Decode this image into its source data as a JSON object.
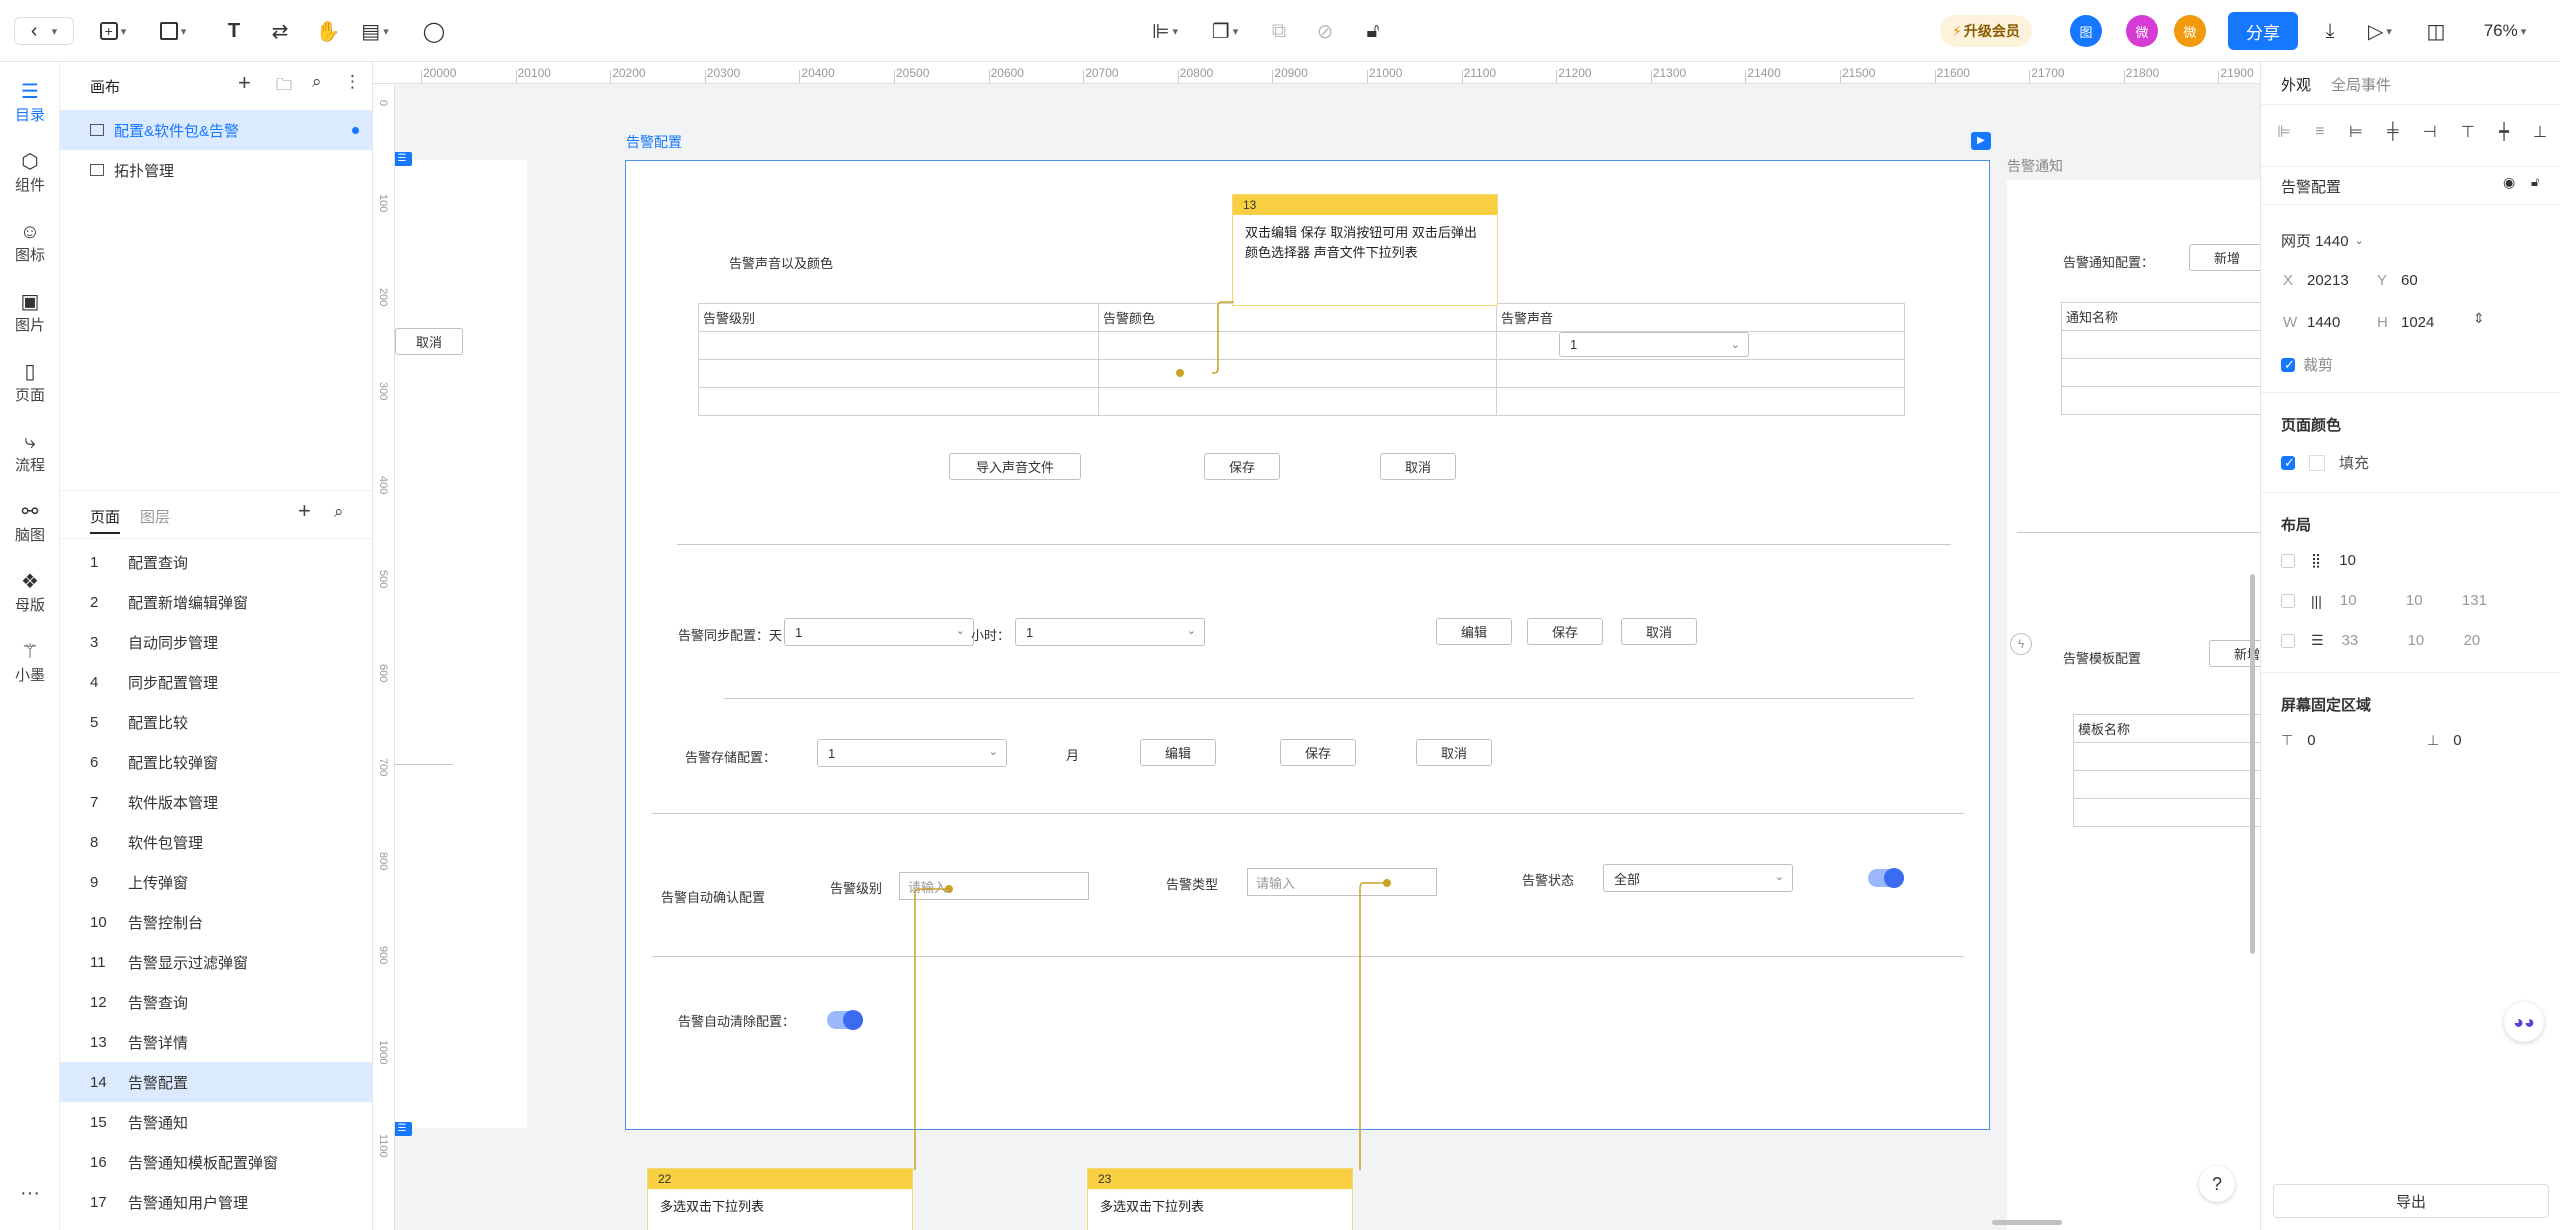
{
  "toolbar": {
    "upgrade_label": "升级会员",
    "share_label": "分享",
    "zoom": "76%",
    "avatars": [
      "图",
      "微",
      "微"
    ]
  },
  "rail": {
    "items": [
      {
        "label": "目录",
        "icon": "list-icon"
      },
      {
        "label": "组件",
        "icon": "cube-icon"
      },
      {
        "label": "图标",
        "icon": "smile-icon"
      },
      {
        "label": "图片",
        "icon": "image-icon"
      },
      {
        "label": "页面",
        "icon": "page-icon"
      },
      {
        "label": "流程",
        "icon": "flow-icon"
      },
      {
        "label": "脑图",
        "icon": "mindmap-icon"
      },
      {
        "label": "母版",
        "icon": "master-icon"
      },
      {
        "label": "小墨",
        "icon": "magic-wand-icon"
      }
    ],
    "more": "···"
  },
  "leftpanel": {
    "title": "画布",
    "canvases": [
      "配置&软件包&告警",
      "拓扑管理"
    ],
    "tabs": [
      "页面",
      "图层"
    ],
    "pages": [
      {
        "num": "1",
        "name": "配置查询"
      },
      {
        "num": "2",
        "name": "配置新增编辑弹窗"
      },
      {
        "num": "3",
        "name": "自动同步管理"
      },
      {
        "num": "4",
        "name": "同步配置管理"
      },
      {
        "num": "5",
        "name": "配置比较"
      },
      {
        "num": "6",
        "name": "配置比较弹窗"
      },
      {
        "num": "7",
        "name": "软件版本管理"
      },
      {
        "num": "8",
        "name": "软件包管理"
      },
      {
        "num": "9",
        "name": "上传弹窗"
      },
      {
        "num": "10",
        "name": "告警控制台"
      },
      {
        "num": "11",
        "name": "告警显示过滤弹窗"
      },
      {
        "num": "12",
        "name": "告警查询"
      },
      {
        "num": "13",
        "name": "告警详情"
      },
      {
        "num": "14",
        "name": "告警配置"
      },
      {
        "num": "15",
        "name": "告警通知"
      },
      {
        "num": "16",
        "name": "告警通知模板配置弹窗"
      },
      {
        "num": "17",
        "name": "告警通知用户管理"
      }
    ]
  },
  "ruler": {
    "h": [
      "20000",
      "20100",
      "20200",
      "20300",
      "20400",
      "20500",
      "20600",
      "20700",
      "20800",
      "20900",
      "21000",
      "21100",
      "21200",
      "21300",
      "21400",
      "21500",
      "21600",
      "21700",
      "21800",
      "21900"
    ],
    "v": [
      "0",
      "100",
      "200",
      "300",
      "400",
      "500",
      "600",
      "700",
      "800",
      "900",
      "1000",
      "1100"
    ]
  },
  "canvas": {
    "left_frame_cancel": "取消",
    "frame_title": "告警配置",
    "right_frame_title": "告警通知",
    "sound_section": "告警声音以及颜色",
    "table_headers": [
      "告警级别",
      "告警颜色",
      "告警声音"
    ],
    "table_select_value": "1",
    "import_btn": "导入声音文件",
    "save_btn": "保存",
    "cancel_btn": "取消",
    "edit_btn": "编辑",
    "sync_label": "告警同步配置：天：",
    "sync_day_value": "1",
    "hour_label": "小时：",
    "sync_hour_value": "1",
    "storage_label": "告警存储配置：",
    "storage_value": "1",
    "month_label": "月",
    "auto_confirm_label": "告警自动确认配置",
    "level_label": "告警级别",
    "input_placeholder": "请输入",
    "type_label": "告警类型",
    "status_label": "告警状态",
    "status_value": "全部",
    "auto_clear_label": "告警自动清除配置：",
    "note13": {
      "num": "13",
      "text": "双击编辑 保存 取消按钮可用 双击后弹出颜色选择器  声音文件下拉列表"
    },
    "note22": {
      "num": "22",
      "text": "多选双击下拉列表"
    },
    "note23": {
      "num": "23",
      "text": "多选双击下拉列表"
    },
    "rf_notify_label": "告警通知配置：",
    "rf_add": "新增",
    "rf_notify_name": "通知名称",
    "rf_template_label": "告警模板配置",
    "rf_template_name": "模板名称"
  },
  "rightpanel": {
    "tabs": [
      "外观",
      "全局事件"
    ],
    "selected_name": "告警配置",
    "page_preset": "网页 1440",
    "x": "20213",
    "y": "60",
    "w": "1440",
    "h": "1024",
    "x_label": "X",
    "y_label": "Y",
    "w_label": "W",
    "h_label": "H",
    "clip_label": "裁剪",
    "page_color_title": "页面颜色",
    "fill_label": "填充",
    "layout_title": "布局",
    "grid_values": [
      "10"
    ],
    "col_values": [
      "10",
      "10",
      "131"
    ],
    "row_values": [
      "33",
      "10",
      "20"
    ],
    "fixed_title": "屏幕固定区域",
    "fixed_top": "0",
    "fixed_bottom": "0",
    "export_label": "导出"
  },
  "colors": {
    "accent": "#1677ff",
    "note": "#f8cf41",
    "frame_border": "#4a90e2"
  }
}
